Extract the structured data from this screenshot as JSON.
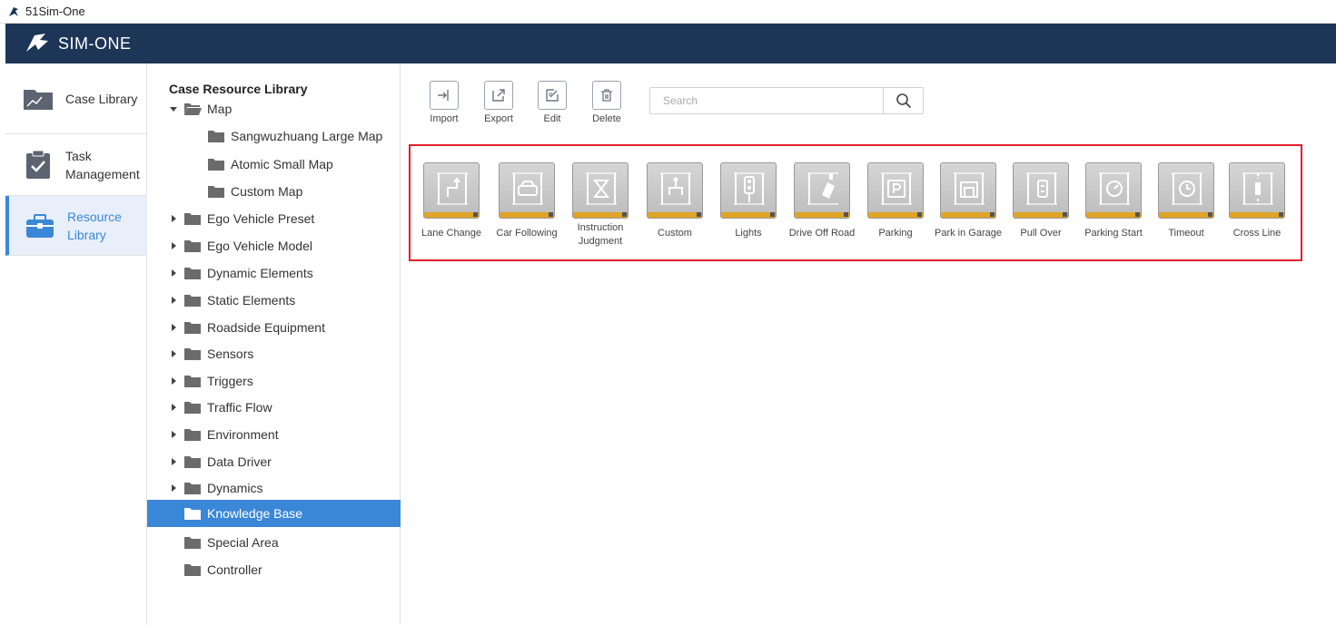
{
  "window": {
    "title": "51Sim-One"
  },
  "app": {
    "brand": "SIM-ONE"
  },
  "nav": [
    {
      "label": "Case Library",
      "icon": "folder-case-icon"
    },
    {
      "label": "Task Management",
      "icon": "clipboard-check-icon"
    },
    {
      "label": "Resource Library",
      "icon": "toolbox-icon",
      "active": true
    }
  ],
  "tree": {
    "heading": "Case Resource Library",
    "items": [
      {
        "label": "Map",
        "expanded": true
      },
      {
        "label": "Sangwuzhuang Large Map"
      },
      {
        "label": "Atomic Small Map"
      },
      {
        "label": "Custom Map"
      },
      {
        "label": "Ego Vehicle Preset"
      },
      {
        "label": "Ego Vehicle Model"
      },
      {
        "label": "Dynamic Elements"
      },
      {
        "label": "Static Elements"
      },
      {
        "label": "Roadside Equipment"
      },
      {
        "label": "Sensors"
      },
      {
        "label": "Triggers"
      },
      {
        "label": "Traffic Flow"
      },
      {
        "label": "Environment"
      },
      {
        "label": "Data Driver"
      },
      {
        "label": "Dynamics"
      },
      {
        "label": "Knowledge Base",
        "selected": true
      },
      {
        "label": "Special Area"
      },
      {
        "label": "Controller"
      }
    ]
  },
  "toolbar": {
    "import": "Import",
    "export": "Export",
    "edit": "Edit",
    "delete": "Delete"
  },
  "search": {
    "placeholder": "Search",
    "value": ""
  },
  "knowledge_items": [
    {
      "label": "Lane Change",
      "icon": "lane-change-icon"
    },
    {
      "label": "Car Following",
      "icon": "car-following-icon"
    },
    {
      "label": "Instruction Judgment",
      "icon": "hourglass-icon"
    },
    {
      "label": "Custom",
      "icon": "custom-icon"
    },
    {
      "label": "Lights",
      "icon": "traffic-light-icon"
    },
    {
      "label": "Drive Off Road",
      "icon": "drive-off-road-icon"
    },
    {
      "label": "Parking",
      "icon": "parking-icon"
    },
    {
      "label": "Park in Garage",
      "icon": "garage-icon"
    },
    {
      "label": "Pull Over",
      "icon": "pull-over-icon"
    },
    {
      "label": "Parking Start",
      "icon": "parking-start-icon"
    },
    {
      "label": "Timeout",
      "icon": "clock-icon"
    },
    {
      "label": "Cross Line",
      "icon": "cross-line-icon"
    }
  ],
  "colors": {
    "header": "#1d3557",
    "accent": "#3a87d8",
    "highlight_border": "#e0202a",
    "tile_bar": "#e0a426"
  }
}
